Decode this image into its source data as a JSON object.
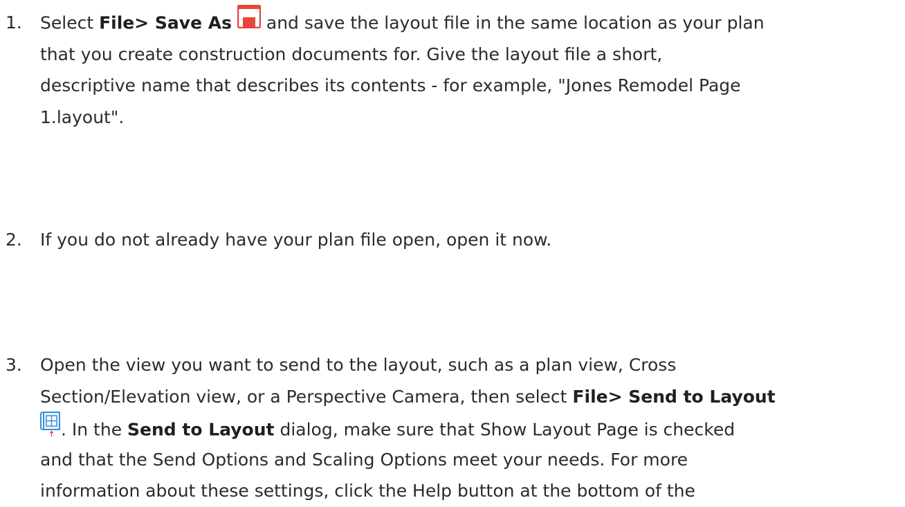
{
  "steps": [
    {
      "number": "1.",
      "line1": {
        "pre": "Select ",
        "bold": "File> Save As",
        "post": " and save the layout file in the same location as your plan"
      },
      "line2": "that you create construction documents for. Give the layout file a short,",
      "line3": "descriptive name that describes its contents - for example, \"Jones Remodel Page",
      "line4": "1.layout\".",
      "icon": "save-as-icon"
    },
    {
      "number": "2.",
      "text": "If you do not already have your plan file open, open it now."
    },
    {
      "number": "3.",
      "line1": "Open the view you want to send to the layout, such as a plan view, Cross",
      "line2": {
        "pre": "Section/Elevation view, or a Perspective Camera, then select ",
        "bold": "File> Send to Layout"
      },
      "line3": {
        "post_icon": ". In the ",
        "bold": "Send to Layout",
        "post": " dialog, make sure that Show Layout Page is checked"
      },
      "line4": "and that the Send Options and Scaling Options meet your needs. For more",
      "line5": "information about these settings, click the Help button at the bottom of the",
      "icon": "send-to-layout-icon"
    }
  ],
  "colors": {
    "text": "#2b2b2b",
    "icon_red": "#e8453c",
    "icon_blue": "#3a8fd8"
  }
}
